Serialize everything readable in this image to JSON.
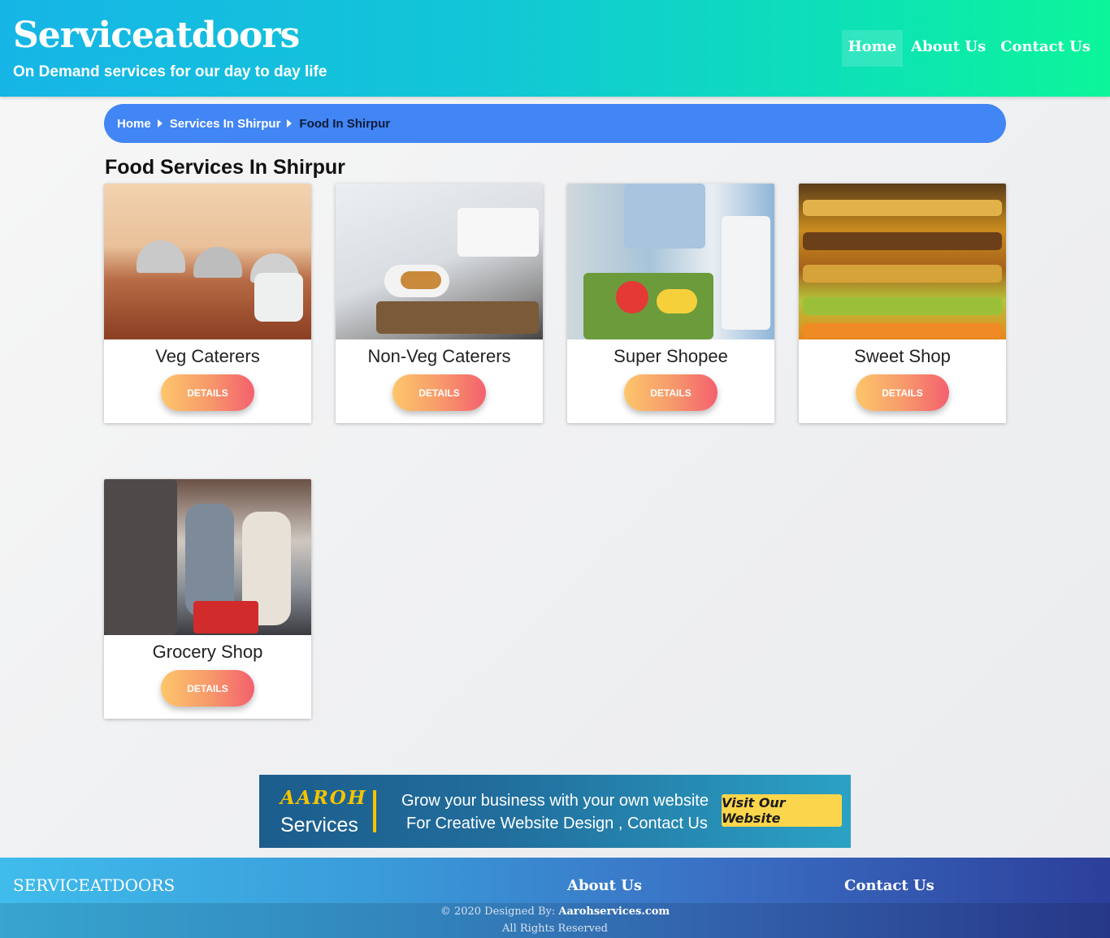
{
  "header": {
    "brand": "Serviceatdoors",
    "tagline": "On Demand services for our day to day life",
    "nav": [
      "Home",
      "About Us",
      "Contact Us"
    ]
  },
  "breadcrumb": [
    "Home",
    "Services In Shirpur",
    "Food In Shirpur"
  ],
  "page_title": "Food Services In Shirpur",
  "cards": [
    {
      "name": "Veg Caterers",
      "button": "DETAILS"
    },
    {
      "name": "Non-Veg Caterers",
      "button": "DETAILS"
    },
    {
      "name": "Super Shopee",
      "button": "DETAILS"
    },
    {
      "name": "Sweet Shop",
      "button": "DETAILS"
    },
    {
      "name": "Grocery Shop",
      "button": "DETAILS"
    }
  ],
  "banner": {
    "logo_top": "AAROH",
    "logo_bottom": "Services",
    "line1": "Grow your business with your own website",
    "line2": "For Creative Website Design , Contact Us",
    "cta": "Visit Our Website"
  },
  "footer": {
    "brand": "SERVICEATDOORS",
    "about": "About Us",
    "contact": "Contact Us",
    "copyright_prefix": "© 2020 Designed By:",
    "copyright_site": "Aarohservices.com",
    "rights": "All Rights Reserved"
  }
}
